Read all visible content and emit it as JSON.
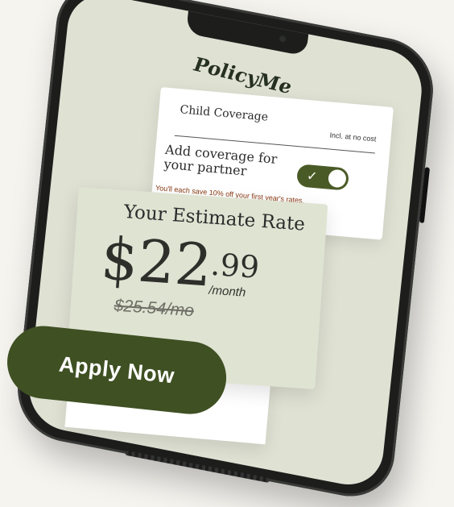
{
  "brand": {
    "logo_text": "PolicyMe"
  },
  "coverage_card": {
    "title": "Child Coverage",
    "included_note": "Incl. at no cost",
    "partner_label": "Add coverage for your partner",
    "toggle_state": "on",
    "savings_note": "You'll each save 10% off your first year's rates."
  },
  "estimate_card": {
    "title": "Your Estimate Rate",
    "price_dollars": "$22",
    "price_cents": ".99",
    "period": "/month",
    "old_price": "$25.54/mo"
  },
  "cta": {
    "label": "Apply Now"
  },
  "colors": {
    "accent_green": "#3f5023",
    "toggle_green": "#4a5a26",
    "savings_text": "#8b3a12",
    "card_bg": "#dfe3d2"
  },
  "icons": {
    "toggle_check": "check-icon"
  }
}
